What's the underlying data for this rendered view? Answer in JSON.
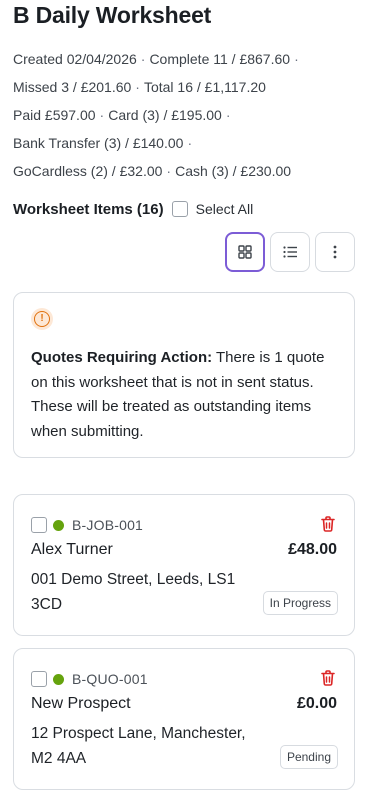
{
  "page": {
    "title": "B Daily Worksheet"
  },
  "summary": {
    "created": "Created 02/04/2026",
    "complete": "Complete 11 / £867.60",
    "missed": "Missed 3 / £201.60",
    "total": "Total 16 / £1,117.20",
    "paid": "Paid £597.00",
    "card": "Card (3) / £195.00",
    "bank_transfer": "Bank Transfer (3) / £140.00",
    "gocardless": "GoCardless (2) / £32.00",
    "cash": "Cash (3) / £230.00",
    "separator": "·"
  },
  "items_header": {
    "title": "Worksheet Items (16)",
    "select_all_label": "Select All"
  },
  "toolbar": {
    "grid_view_icon": "grid-icon",
    "list_view_icon": "list-icon",
    "more_icon": "more-vertical-icon"
  },
  "alert": {
    "icon": "warning-circle-icon",
    "bold_label": "Quotes Requiring Action:",
    "message": "There is 1 quote on this worksheet that is not in sent status. These will be treated as outstanding items when submitting."
  },
  "items": [
    {
      "ref": "B-JOB-001",
      "customer": "Alex Turner",
      "amount": "£48.00",
      "address": "001 Demo Street, Leeds, LS1 3CD",
      "status": "In Progress"
    },
    {
      "ref": "B-QUO-001",
      "customer": "New Prospect",
      "amount": "£0.00",
      "address": "12 Prospect Lane, Manchester, M2 4AA",
      "status": "Pending"
    }
  ],
  "colors": {
    "accent": "#7c5cd6",
    "warning": "#e0720f",
    "status_dot": "#65a30d",
    "delete": "#dc2626"
  }
}
